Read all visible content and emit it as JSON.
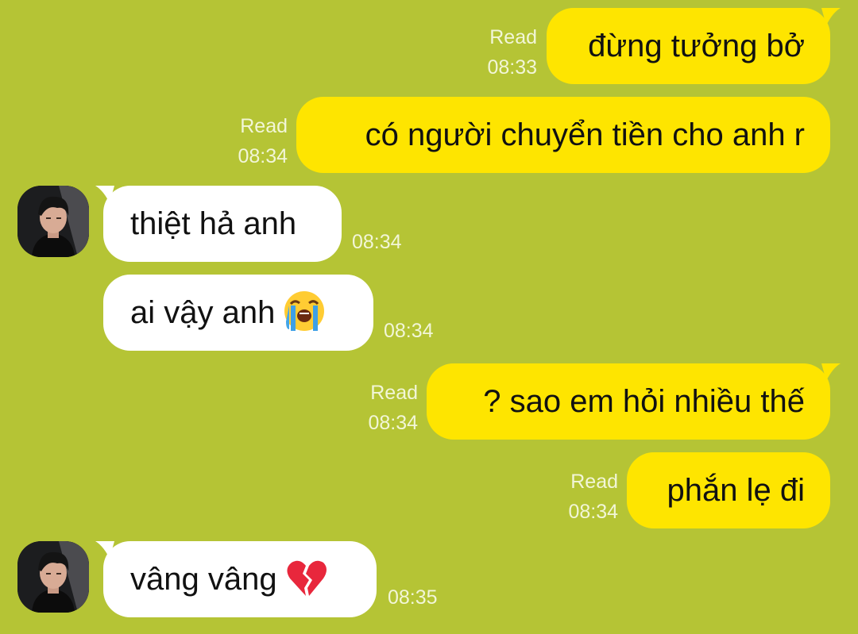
{
  "chat": {
    "messages": [
      {
        "side": "out",
        "text": "đừng tưởng bở",
        "status": "Read",
        "time": "08:33"
      },
      {
        "side": "out",
        "text": "có người chuyển tiền cho anh r",
        "status": "Read",
        "time": "08:34"
      },
      {
        "side": "in",
        "text": "thiệt hả anh",
        "time": "08:34"
      },
      {
        "side": "in",
        "text": "ai vậy anh",
        "emoji": "loudly-crying-face",
        "time": "08:34"
      },
      {
        "side": "out",
        "text": "? sao em hỏi nhiều thế",
        "status": "Read",
        "time": "08:34"
      },
      {
        "side": "out",
        "text": "phắn lẹ đi",
        "status": "Read",
        "time": "08:34"
      },
      {
        "side": "in",
        "text": "vâng vâng",
        "emoji": "broken-heart",
        "time": "08:35"
      }
    ]
  },
  "colors": {
    "background": "#b5c435",
    "outgoing_bubble": "#fee500",
    "incoming_bubble": "#ffffff",
    "meta_text": "#f2f6d8"
  }
}
